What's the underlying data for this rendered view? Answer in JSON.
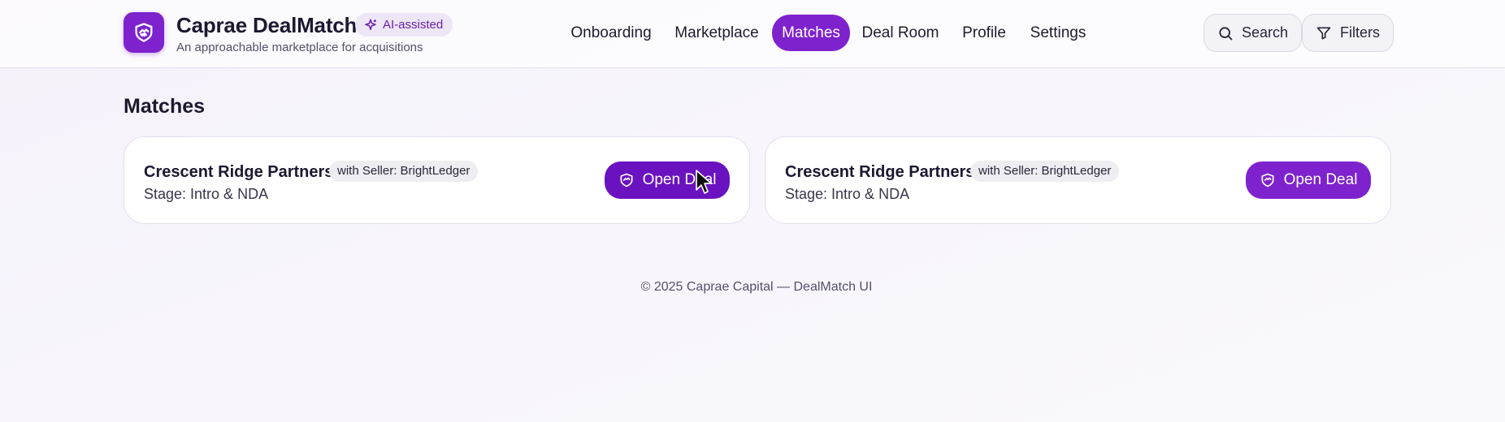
{
  "brand": {
    "title": "Caprae DealMatch",
    "subtitle": "An approachable marketplace for acquisitions",
    "badge": "AI-assisted",
    "logo_icon": "handshake-icon",
    "accent": "#7e22ce"
  },
  "nav": {
    "items": [
      {
        "label": "Onboarding",
        "active": false
      },
      {
        "label": "Marketplace",
        "active": false
      },
      {
        "label": "Matches",
        "active": true
      },
      {
        "label": "Deal Room",
        "active": false
      },
      {
        "label": "Profile",
        "active": false
      },
      {
        "label": "Settings",
        "active": false
      }
    ]
  },
  "header_actions": {
    "search_label": "Search",
    "filters_label": "Filters"
  },
  "page": {
    "title": "Matches"
  },
  "matches": [
    {
      "name": "Crescent Ridge Partners",
      "tag": "with Seller: BrightLedger",
      "stage": "Stage: Intro & NDA",
      "button": "Open Deal"
    },
    {
      "name": "Crescent Ridge Partners",
      "tag": "with Seller: BrightLedger",
      "stage": "Stage: Intro & NDA",
      "button": "Open Deal"
    }
  ],
  "footer": {
    "text": "© 2025 Caprae Capital — DealMatch UI"
  }
}
